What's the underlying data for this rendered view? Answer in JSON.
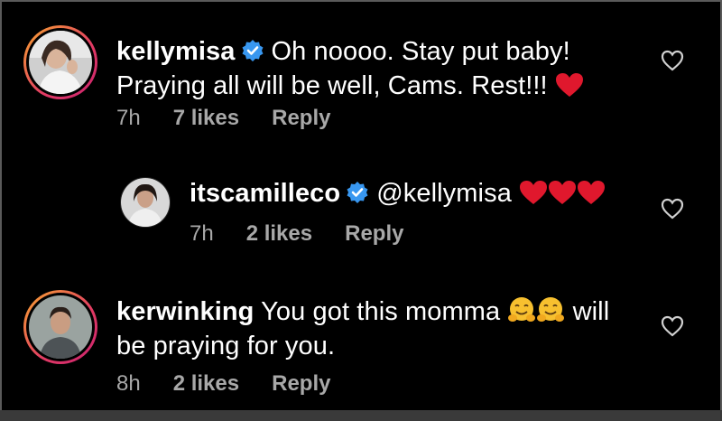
{
  "comments": [
    {
      "username": "kellymisa",
      "verified": true,
      "line1": "Oh noooo. Stay put baby!",
      "line2": "Praying all will be well, Cams. Rest!!!",
      "time": "7h",
      "likes": "7 likes",
      "reply": "Reply"
    },
    {
      "username": "itscamilleco",
      "verified": true,
      "line1": "@kellymisa",
      "time": "7h",
      "likes": "2 likes",
      "reply": "Reply"
    },
    {
      "username": "kerwinking",
      "verified": false,
      "line1a": "You got this momma",
      "line1b": "will",
      "line2": "be praying for you.",
      "time": "8h",
      "likes": "2 likes",
      "reply": "Reply"
    }
  ],
  "colors": {
    "background": "#000000",
    "text": "#ffffff",
    "meta": "#a8a8a8",
    "verified": "#3897f0",
    "heart_emoji": "#e0182d"
  }
}
